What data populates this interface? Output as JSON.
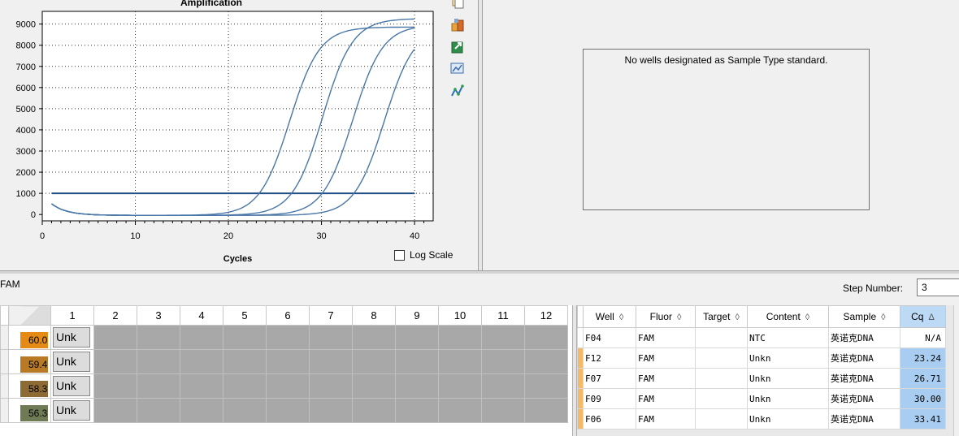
{
  "chart": {
    "title": "Amplification",
    "xlabel": "Cycles",
    "log_scale_label": "Log Scale",
    "log_scale_checked": false
  },
  "chart_data": {
    "type": "line",
    "title": "Amplification",
    "xlabel": "Cycles",
    "ylabel": "",
    "xlim": [
      0,
      42
    ],
    "ylim": [
      -300,
      9600
    ],
    "x_ticks": [
      0,
      10,
      20,
      30,
      40
    ],
    "y_ticks": [
      0,
      1000,
      2000,
      3000,
      4000,
      5000,
      6000,
      7000,
      8000,
      9000
    ],
    "threshold": 1000,
    "grid": "dotted",
    "series": [
      {
        "values_cq": 23.24,
        "plateau": 8900
      },
      {
        "values_cq": 26.71,
        "plateau": 9300
      },
      {
        "values_cq": 30.0,
        "plateau": 9000
      },
      {
        "values_cq": 33.41,
        "plateau": 8900
      }
    ],
    "colors": {
      "curve": "#4a77a8",
      "threshold": "#1f4e86",
      "axis": "#000000"
    }
  },
  "toolbar": {
    "icons": [
      "copy-icon",
      "export-icon",
      "excel-export-icon",
      "chart-options-icon",
      "curve-fit-icon"
    ]
  },
  "std_curve": {
    "message": "No wells designated as Sample Type standard."
  },
  "fluor_bar": {
    "fluor": "FAM",
    "step_label": "Step Number:",
    "step_value": "3"
  },
  "plate": {
    "columns": [
      "1",
      "2",
      "3",
      "4",
      "5",
      "6",
      "7",
      "8",
      "9",
      "10",
      "11",
      "12"
    ],
    "rows": [
      {
        "temp": "60.0",
        "temp_color": "#e58a14",
        "well": "Unk"
      },
      {
        "temp": "59.4",
        "temp_color": "#b97a26",
        "well": "Unk"
      },
      {
        "temp": "58.3",
        "temp_color": "#8e6a34",
        "well": "Unk"
      },
      {
        "temp": "56.3",
        "temp_color": "#6f7b55",
        "well": "Unk"
      }
    ]
  },
  "results": {
    "headers": [
      "Well",
      "Fluor",
      "Target",
      "Content",
      "Sample",
      "Cq"
    ],
    "rows": [
      {
        "well": "F04",
        "fluor": "FAM",
        "target": "",
        "content": "NTC",
        "sample": "英诺克DNA",
        "cq": "N/A",
        "highlight": false
      },
      {
        "well": "F12",
        "fluor": "FAM",
        "target": "",
        "content": "Unkn",
        "sample": "英诺克DNA",
        "cq": "23.24",
        "highlight": true
      },
      {
        "well": "F07",
        "fluor": "FAM",
        "target": "",
        "content": "Unkn",
        "sample": "英诺克DNA",
        "cq": "26.71",
        "highlight": true
      },
      {
        "well": "F09",
        "fluor": "FAM",
        "target": "",
        "content": "Unkn",
        "sample": "英诺克DNA",
        "cq": "30.00",
        "highlight": true
      },
      {
        "well": "F06",
        "fluor": "FAM",
        "target": "",
        "content": "Unkn",
        "sample": "英诺克DNA",
        "cq": "33.41",
        "highlight": true
      }
    ]
  }
}
